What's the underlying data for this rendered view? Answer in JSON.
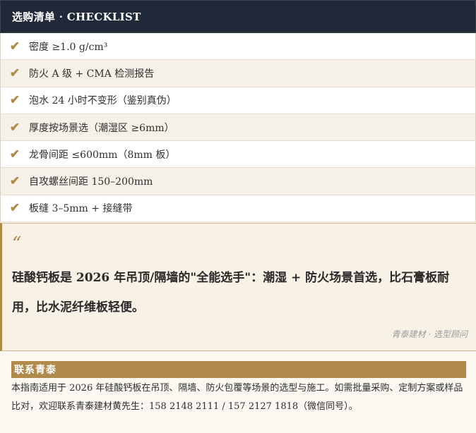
{
  "header": {
    "title": "选购清单 · CHECKLIST"
  },
  "checklist": {
    "items": [
      {
        "icon": "checkmark-icon",
        "text": "密度 ≥1.0 g/cm³"
      },
      {
        "icon": "checkmark-icon",
        "text": "防火 A 级 + CMA 检测报告"
      },
      {
        "icon": "checkmark-icon",
        "text": "泡水 24 小时不变形（鉴别真伪）"
      },
      {
        "icon": "checkmark-icon",
        "text": "厚度按场景选（潮湿区 ≥6mm）"
      },
      {
        "icon": "checkmark-icon",
        "text": "龙骨间距 ≤600mm（8mm 板）"
      },
      {
        "icon": "checkmark-icon",
        "text": "自攻螺丝间距 150–200mm"
      },
      {
        "icon": "checkmark-icon",
        "text": "板缝 3–5mm + 接缝带"
      }
    ]
  },
  "quote": {
    "mark": "“",
    "text": "硅酸钙板是 2026 年吊顶/隔墙的\"全能选手\"：潮湿 + 防火场景首选，比石膏板耐用，比水泥纤维板轻便。",
    "source": "青泰建材 · 选型顾问"
  },
  "contact": {
    "title": "联系青泰",
    "text": "本指南适用于 2026 年硅酸钙板在吊顶、隔墙、防火包覆等场景的选型与施工。如需批量采购、定制方案或样品比对，欢迎联系青泰建材黄先生：158 2148 2111 / 157 2127 1818（微信同号）。"
  },
  "colors": {
    "header_bg": "#1f2937",
    "accent": "#b08a4a"
  }
}
